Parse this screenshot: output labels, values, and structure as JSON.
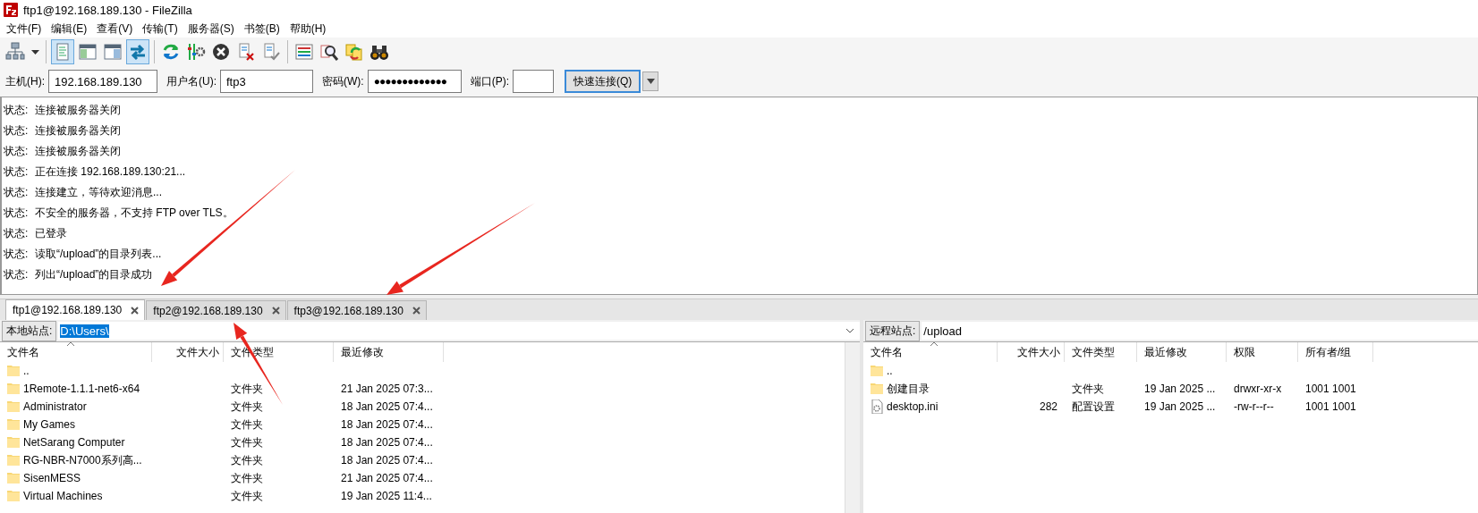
{
  "window": {
    "title": "ftp1@192.168.189.130 - FileZilla"
  },
  "menu": [
    "文件(F)",
    "编辑(E)",
    "查看(V)",
    "传输(T)",
    "服务器(S)",
    "书签(B)",
    "帮助(H)"
  ],
  "toolbar": [
    {
      "kind": "site-manager"
    },
    {
      "kind": "dropdown"
    },
    {
      "kind": "separator"
    },
    {
      "kind": "log-toggle",
      "pressed": true
    },
    {
      "kind": "local-tree-toggle",
      "pressed": false
    },
    {
      "kind": "remote-tree-toggle",
      "pressed": false
    },
    {
      "kind": "queue-toggle",
      "pressed": true
    },
    {
      "kind": "separator"
    },
    {
      "kind": "refresh"
    },
    {
      "kind": "filter"
    },
    {
      "kind": "cancel"
    },
    {
      "kind": "disconnect"
    },
    {
      "kind": "reconnect"
    },
    {
      "kind": "separator"
    },
    {
      "kind": "listing-filter"
    },
    {
      "kind": "search"
    },
    {
      "kind": "sync"
    },
    {
      "kind": "binoculars"
    }
  ],
  "quickconnect": {
    "host": {
      "label": "主机(H):",
      "value": "192.168.189.130"
    },
    "user": {
      "label": "用户名(U):",
      "value": "ftp3"
    },
    "password": {
      "label": "密码(W):",
      "value": "●●●●●●●●●●●●●"
    },
    "port": {
      "label": "端口(P):"
    },
    "button": "快速连接(Q)"
  },
  "log": [
    {
      "label": "状态:",
      "message": "连接被服务器关闭"
    },
    {
      "label": "状态:",
      "message": "连接被服务器关闭"
    },
    {
      "label": "状态:",
      "message": "连接被服务器关闭"
    },
    {
      "label": "状态:",
      "message": "正在连接 192.168.189.130:21..."
    },
    {
      "label": "状态:",
      "message": "连接建立，等待欢迎消息..."
    },
    {
      "label": "状态:",
      "message": "不安全的服务器，不支持 FTP over TLS。"
    },
    {
      "label": "状态:",
      "message": "已登录"
    },
    {
      "label": "状态:",
      "message": "读取“/upload”的目录列表..."
    },
    {
      "label": "状态:",
      "message": "列出“/upload”的目录成功"
    }
  ],
  "tabs": [
    {
      "label": "ftp1@192.168.189.130",
      "selected": true
    },
    {
      "label": "ftp2@192.168.189.130",
      "selected": false
    },
    {
      "label": "ftp3@192.168.189.130",
      "selected": false
    }
  ],
  "local": {
    "site_label": "本地站点:",
    "path": "D:\\Users\\",
    "path_selected": true,
    "columns": [
      "文件名",
      "文件大小",
      "文件类型",
      "最近修改"
    ],
    "rows": [
      {
        "kind": "folder",
        "name": ".."
      },
      {
        "kind": "folder",
        "name": "1Remote-1.1.1-net6-x64",
        "type": "文件夹",
        "modified": "21 Jan 2025 07:3..."
      },
      {
        "kind": "folder",
        "name": "Administrator",
        "type": "文件夹",
        "modified": "18 Jan 2025 07:4..."
      },
      {
        "kind": "folder",
        "name": "My Games",
        "type": "文件夹",
        "modified": "18 Jan 2025 07:4..."
      },
      {
        "kind": "folder",
        "name": "NetSarang Computer",
        "type": "文件夹",
        "modified": "18 Jan 2025 07:4..."
      },
      {
        "kind": "folder",
        "name": "RG-NBR-N7000系列高...",
        "type": "文件夹",
        "modified": "18 Jan 2025 07:4..."
      },
      {
        "kind": "folder",
        "name": "SisenMESS",
        "type": "文件夹",
        "modified": "21 Jan 2025 07:4..."
      },
      {
        "kind": "folder",
        "name": "Virtual Machines",
        "type": "文件夹",
        "modified": "19 Jan 2025 11:4..."
      }
    ]
  },
  "remote": {
    "site_label": "远程站点:",
    "path": "/upload",
    "path_selected": false,
    "columns": [
      "文件名",
      "文件大小",
      "文件类型",
      "最近修改",
      "权限",
      "所有者/组"
    ],
    "rows": [
      {
        "kind": "folder",
        "name": ".."
      },
      {
        "kind": "folder",
        "name": "创建目录",
        "type": "文件夹",
        "modified": "19 Jan 2025 ...",
        "permissions": "drwxr-xr-x",
        "owner": "1001 1001"
      },
      {
        "kind": "file",
        "name": "desktop.ini",
        "size": "282",
        "type": "配置设置",
        "modified": "19 Jan 2025 ...",
        "permissions": "-rw-r--r--",
        "owner": "1001 1001"
      }
    ]
  },
  "annotations": [
    {
      "kind": "arrow"
    },
    {
      "kind": "arrow"
    },
    {
      "kind": "arrow"
    }
  ]
}
